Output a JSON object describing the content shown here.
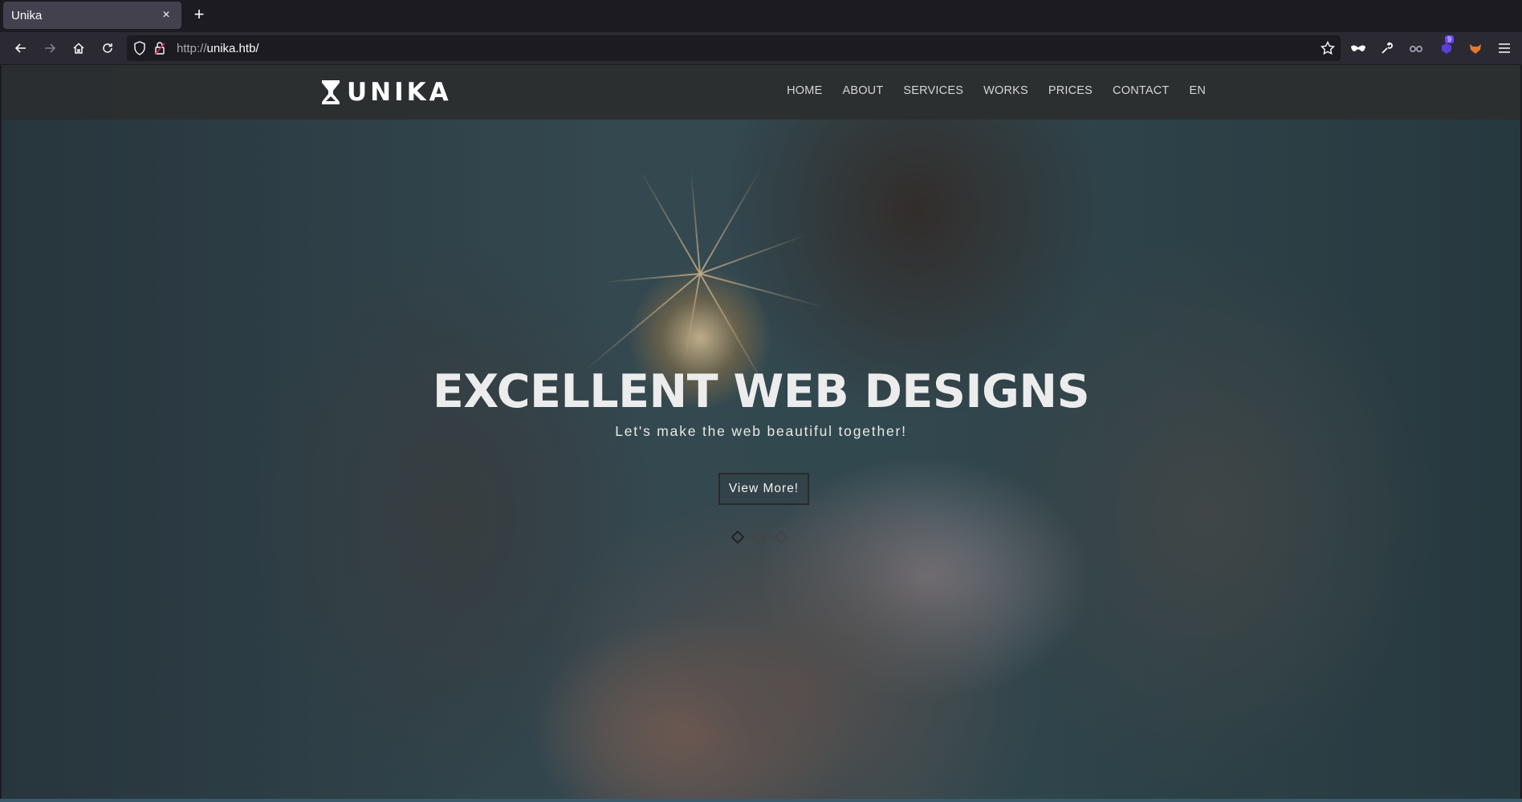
{
  "browser": {
    "tab_title": "Unika",
    "tab_close": "×",
    "new_tab": "+",
    "url_protocol": "http://",
    "url_host": "unika.htb/",
    "extension_badge": "9"
  },
  "site": {
    "logo_text": "UNIKA",
    "menu": [
      "HOME",
      "ABOUT",
      "SERVICES",
      "WORKS",
      "PRICES",
      "CONTACT",
      "EN"
    ]
  },
  "hero": {
    "title": "EXCELLENT WEB DESIGNS",
    "subtitle": "Let's make the web beautiful together!",
    "button_label": "View More!",
    "slides": 3,
    "active_slide": 1
  },
  "colors": {
    "tab_bg": "#42414d",
    "header_bg": "#2b2e30",
    "menu_text": "#d6d6d6"
  }
}
